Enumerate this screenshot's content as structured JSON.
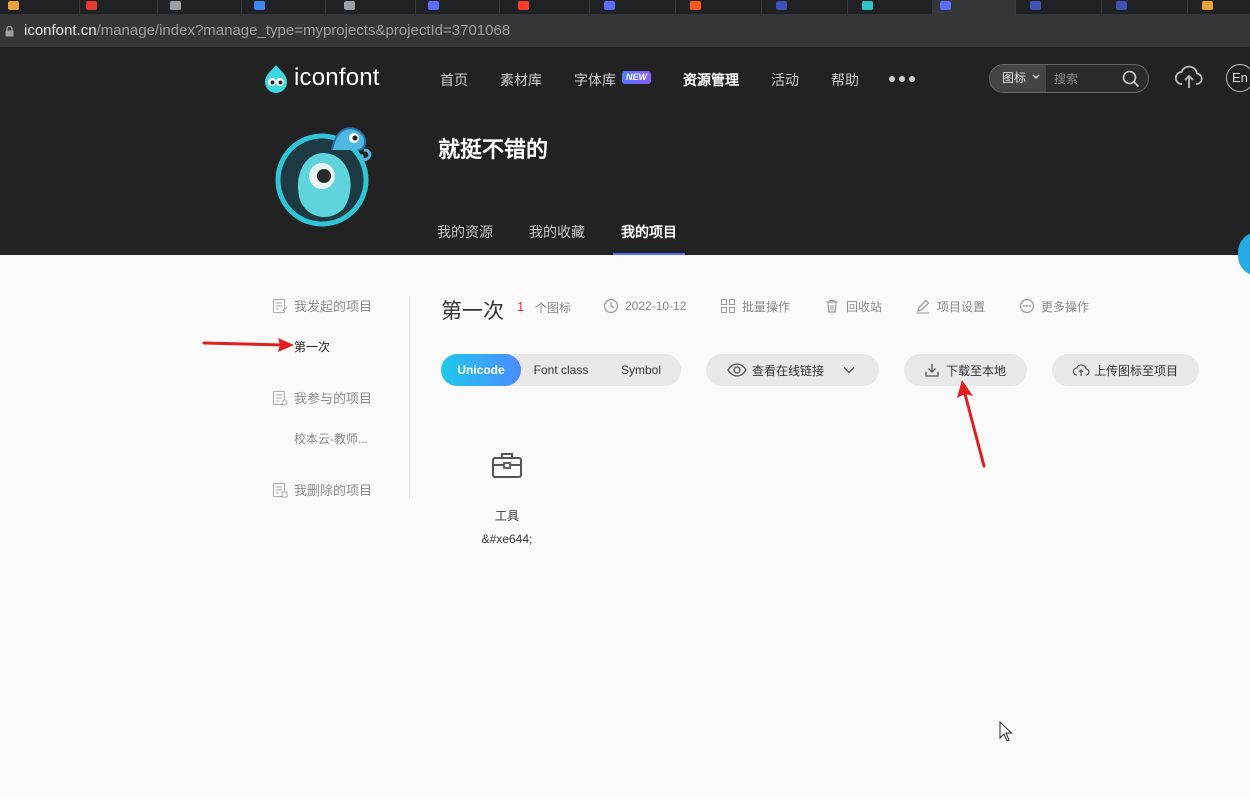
{
  "browser": {
    "tab_favicon_colors": [
      "#e8a33a",
      "#e53935",
      "#9aa0a6",
      "#4285f4",
      "#9aa0a6",
      "#5b6cff",
      "#ff3b30",
      "#5b6cff",
      "#ff5722",
      "#3f51b5",
      "#2ec7c9",
      "#5b6cff",
      "#3f51b5",
      "#3f51b5"
    ],
    "url_host": "iconfont.cn",
    "url_path": "/manage/index?manage_type=myprojects&projectId=3701068"
  },
  "header": {
    "logo_text": "iconfont",
    "nav": [
      "首页",
      "素材库",
      "字体库",
      "资源管理",
      "活动",
      "帮助"
    ],
    "nav_active": "资源管理",
    "new_badge": "NEW",
    "search_type": "图标",
    "search_placeholder": "搜索",
    "lang": "En"
  },
  "profile": {
    "name": "就挺不错的",
    "tabs": [
      "我的资源",
      "我的收藏",
      "我的项目"
    ],
    "active_tab": "我的项目"
  },
  "sidebar": {
    "groups": [
      {
        "label": "我发起的项目",
        "items": [
          {
            "label": "第一次",
            "active": true
          }
        ]
      },
      {
        "label": "我参与的项目",
        "items": [
          {
            "label": "校本云-教师...",
            "active": false
          }
        ]
      },
      {
        "label": "我删除的项目",
        "items": []
      }
    ]
  },
  "project": {
    "title": "第一次",
    "icon_count": "1",
    "icon_count_label": "个图标",
    "date": "2022-10-12",
    "ops": [
      "批量操作",
      "回收站",
      "项目设置",
      "更多操作"
    ]
  },
  "toolbar": {
    "format_tabs": [
      "Unicode",
      "Font class",
      "Symbol"
    ],
    "active_format": "Unicode",
    "view_link": "查看在线链接",
    "download": "下载至本地",
    "upload": "上传图标至项目"
  },
  "icons": [
    {
      "name": "工具",
      "code": "&#xe644;",
      "glyph": "toolbox-icon"
    }
  ],
  "colors": {
    "header_bg": "#222222",
    "accent": "#5a6cff",
    "count_red": "#e0302f",
    "annotation_red": "#e02020"
  }
}
